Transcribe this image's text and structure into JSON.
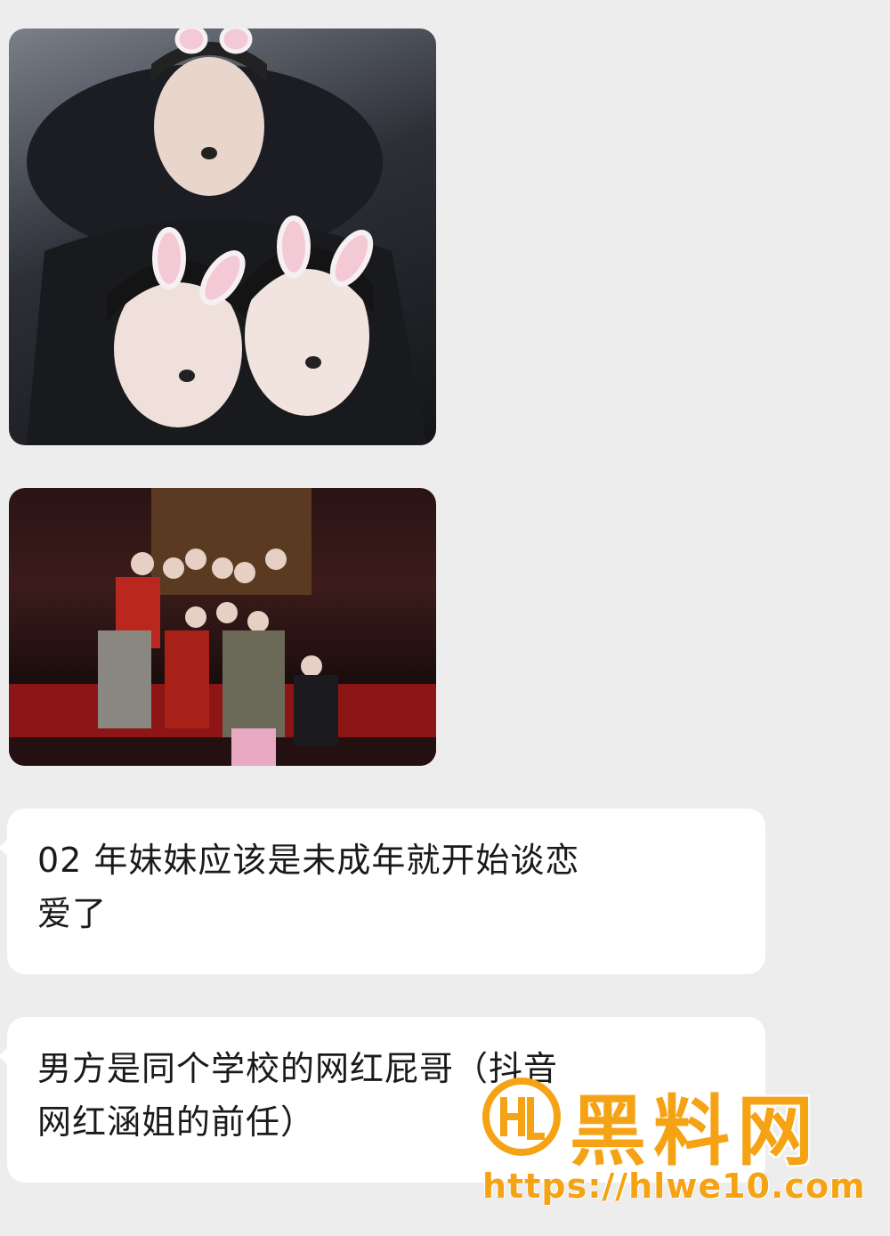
{
  "messages": [
    {
      "type": "image",
      "description_icon": "photo-selfie-bunny-filter"
    },
    {
      "type": "image",
      "description_icon": "photo-group-party"
    },
    {
      "type": "text",
      "lines": [
        "02 年妹妹应该是未成年就开始谈恋",
        "爱了"
      ]
    },
    {
      "type": "text",
      "lines": [
        "男方是同个学校的网红屁哥（抖音",
        "网红涵姐的前任）"
      ]
    }
  ],
  "watermark": {
    "title": "黑料网",
    "url": "https://hlwe10.com",
    "color": "#f5a315"
  },
  "colors": {
    "background": "#ededed",
    "bubble": "#ffffff",
    "text": "#1a1a1a"
  }
}
